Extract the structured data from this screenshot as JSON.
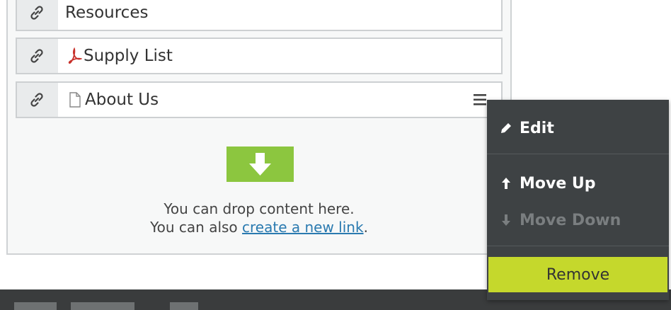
{
  "rows": [
    {
      "title": "Resources",
      "icon": "link-icon",
      "file_icon": ""
    },
    {
      "title": "Supply List",
      "icon": "link-icon",
      "file_icon": "pdf-icon"
    },
    {
      "title": "About Us",
      "icon": "link-icon",
      "file_icon": "document-icon"
    }
  ],
  "dropzone": {
    "line1": "You can drop content here.",
    "line2_prefix": "You can also ",
    "line2_link": "create a new link",
    "line2_suffix": "."
  },
  "context_menu": {
    "edit": "Edit",
    "move_up": "Move Up",
    "move_down": "Move Down",
    "remove": "Remove"
  },
  "colors": {
    "accent_green": "#8cc63f",
    "remove_highlight": "#c5d82c",
    "menu_bg": "#3e4244",
    "link": "#2a7ab0"
  }
}
